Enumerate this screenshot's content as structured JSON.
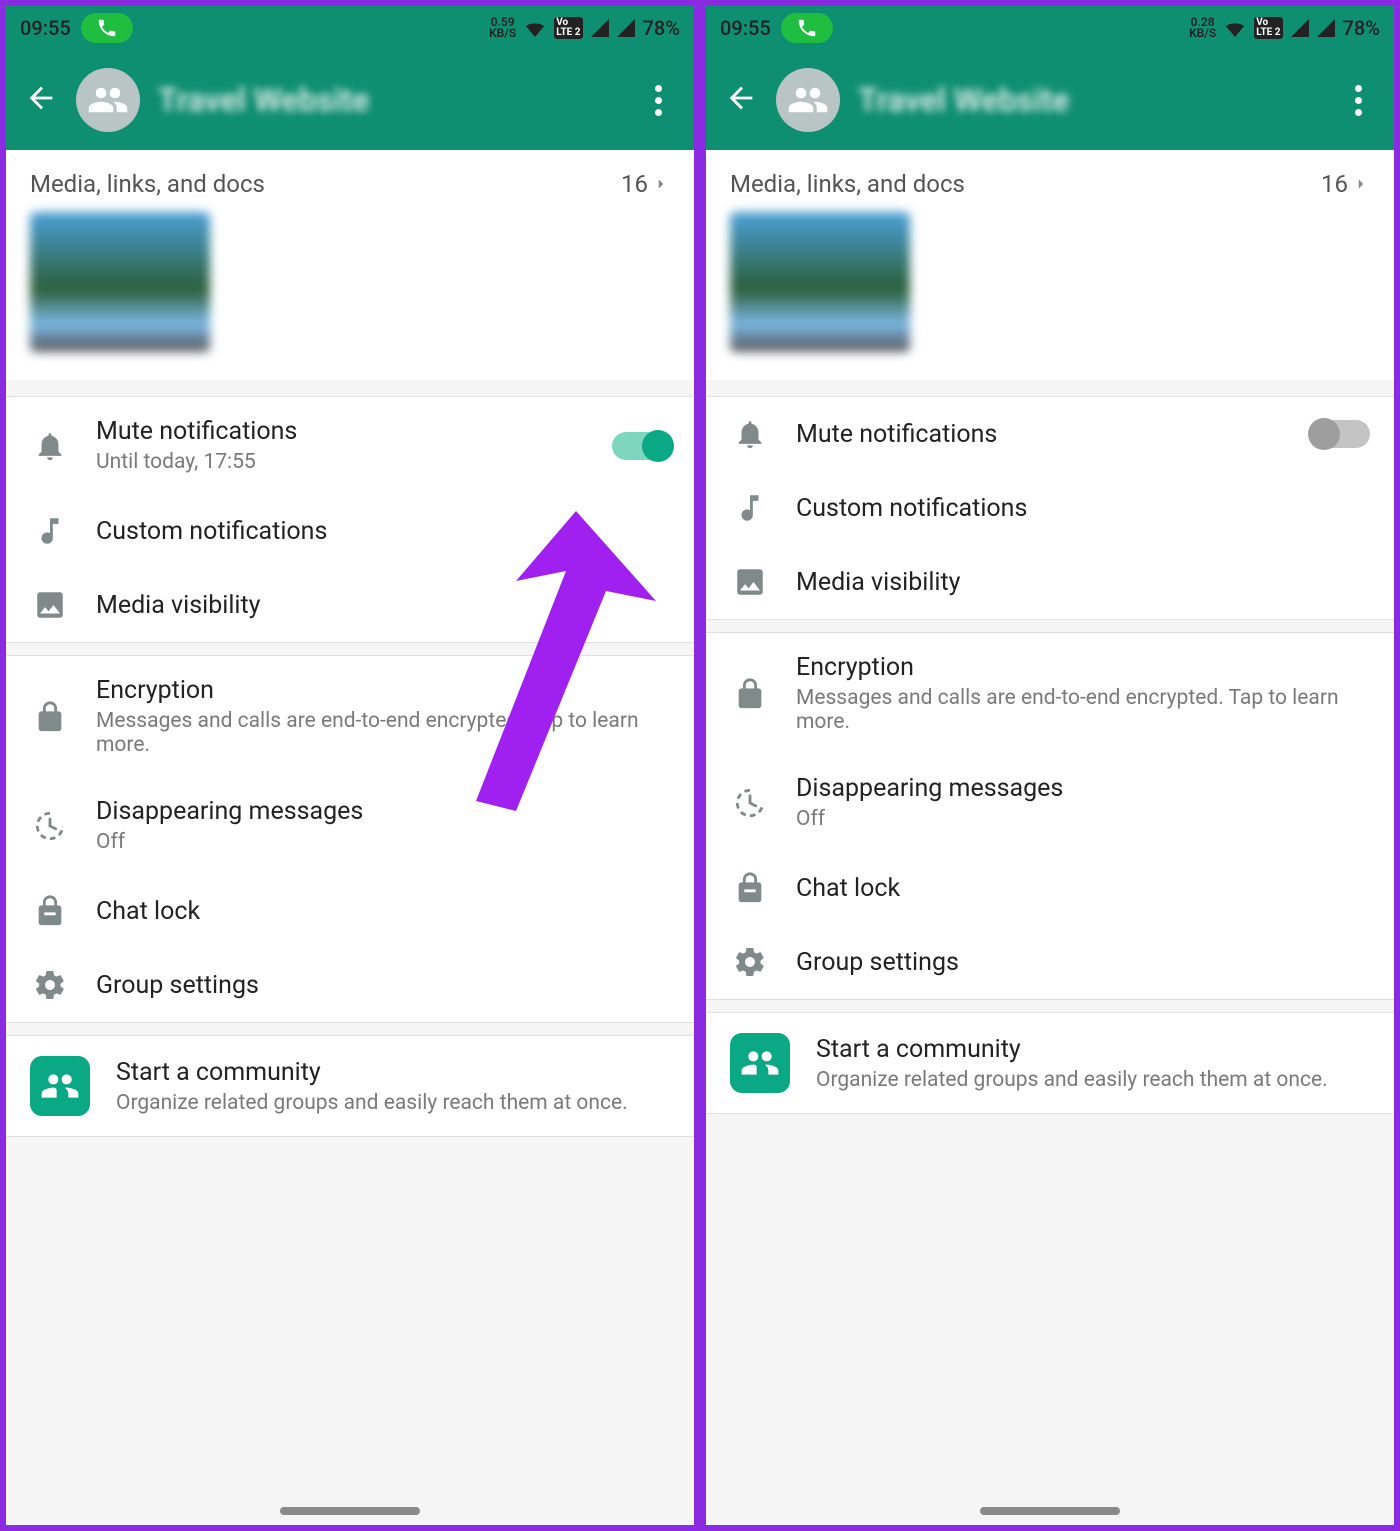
{
  "status": {
    "time": "09:55",
    "battery": "78%",
    "net_left": "0.59",
    "net_right": "0.28",
    "kbs_label": "KB/S"
  },
  "header": {
    "title": "Travel Website"
  },
  "media": {
    "label": "Media, links, and docs",
    "count": "16"
  },
  "left": {
    "mute": {
      "title": "Mute notifications",
      "sub": "Until today, 17:55",
      "on": true
    }
  },
  "right": {
    "mute": {
      "title": "Mute notifications",
      "on": false
    }
  },
  "rows": {
    "custom": "Custom notifications",
    "media_vis": "Media visibility",
    "encryption": {
      "title": "Encryption",
      "sub": "Messages and calls are end-to-end encrypted. Tap to learn more."
    },
    "disappearing": {
      "title": "Disappearing messages",
      "sub": "Off"
    },
    "chat_lock": "Chat lock",
    "group_settings": "Group settings",
    "community": {
      "title": "Start a community",
      "sub": "Organize related groups and easily reach them at once."
    }
  }
}
